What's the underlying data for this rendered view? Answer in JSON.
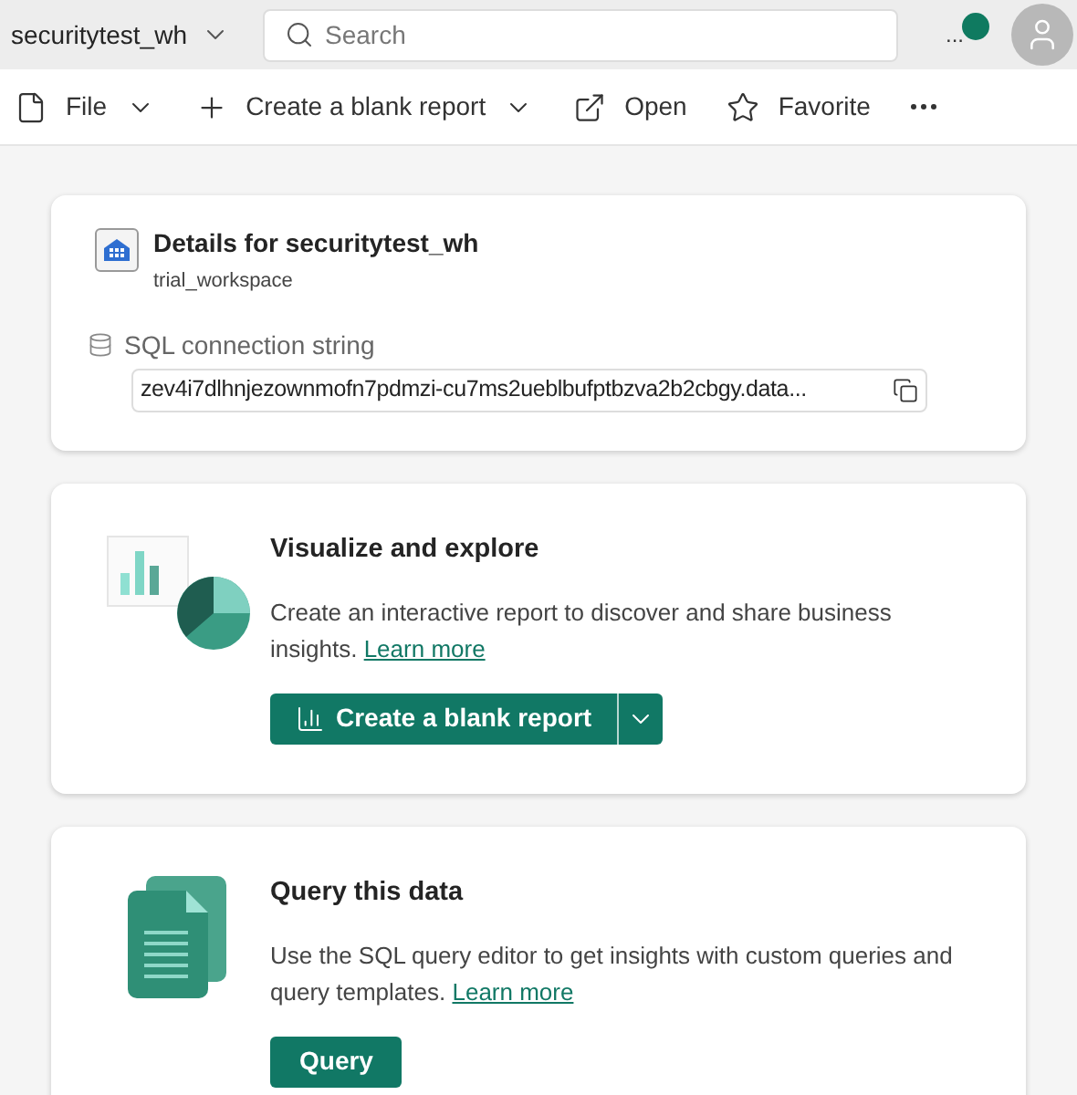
{
  "header": {
    "workspace": "securitytest_wh",
    "search": {
      "placeholder": "Search"
    },
    "more": "...",
    "notification": true
  },
  "toolbar": [
    {
      "kind": "file",
      "label": "File",
      "has_menu": true
    },
    {
      "kind": "new",
      "label": "Create a blank report",
      "has_menu": true
    },
    {
      "kind": "open",
      "label": "Open",
      "has_menu": false
    },
    {
      "kind": "favorite",
      "label": "Favorite",
      "has_menu": false
    },
    {
      "kind": "more"
    }
  ],
  "details": {
    "title": "Details for securitytest_wh",
    "subtitle": "trial_workspace",
    "connection_label": "SQL connection string",
    "connection_value": "zev4i7dlhnjezownmofn7pdmzi-cu7ms2ueblbufptbzva2b2cbgy.data..."
  },
  "cards": [
    {
      "kind": "report",
      "title": "Visualize and explore",
      "text": "Create an interactive report to discover and share business insights.",
      "link": "Learn more",
      "button": "Create a blank report",
      "split": true
    },
    {
      "kind": "query",
      "title": "Query this data",
      "text": "Use the SQL query editor to get insights with custom queries and query templates.",
      "link": "Learn more",
      "button": "Query",
      "split": false
    }
  ]
}
